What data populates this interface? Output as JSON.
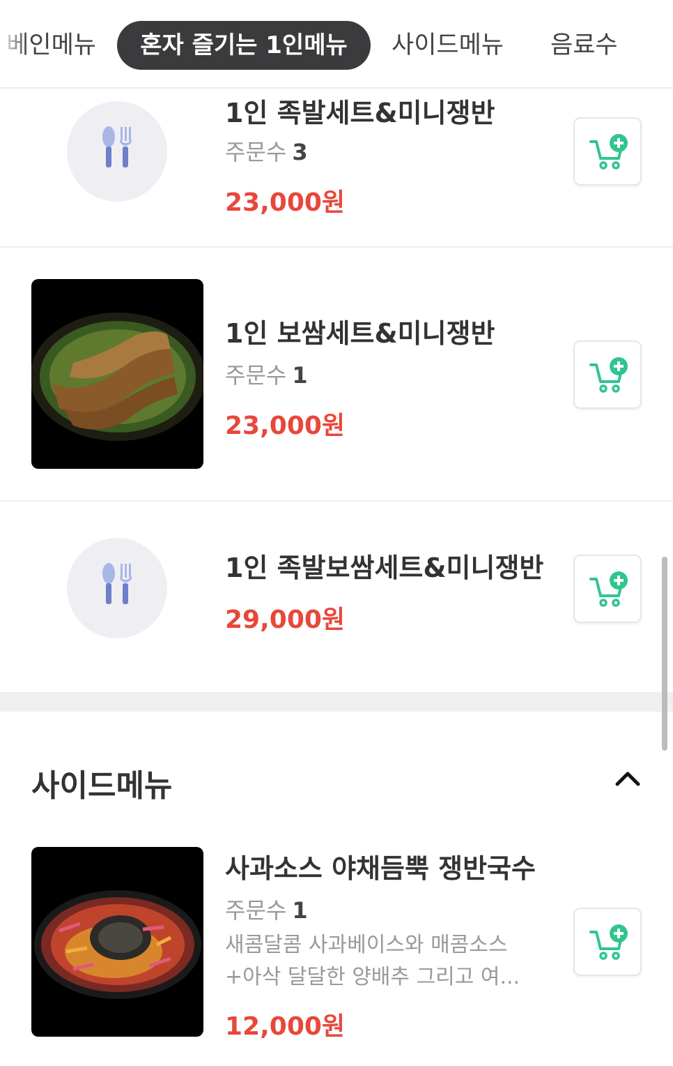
{
  "tabs": [
    {
      "label": "베인메뉴",
      "active": false
    },
    {
      "label": "혼자 즐기는 1인메뉴",
      "active": true
    },
    {
      "label": "사이드메뉴",
      "active": false
    },
    {
      "label": "음료수",
      "active": false
    }
  ],
  "items": [
    {
      "name": "1인 족발세트&미니쟁반",
      "orders_label": "주문수",
      "orders": "3",
      "price": "23,000원"
    },
    {
      "name": "1인 보쌈세트&미니쟁반",
      "orders_label": "주문수",
      "orders": "1",
      "price": "23,000원"
    },
    {
      "name": "1인 족발보쌈세트&미니쟁반",
      "price": "29,000원"
    }
  ],
  "side_section": {
    "title": "사이드메뉴",
    "items": [
      {
        "name": "사과소스 야채듬뿍 쟁반국수",
        "orders_label": "주문수",
        "orders": "1",
        "desc_line1": "새콤달콤 사과베이스와 매콤소스",
        "desc_line2": "+아삭 달달한 양배추 그리고 여...",
        "price": "12,000원"
      }
    ]
  },
  "colors": {
    "accent_green": "#2fc58f",
    "price_red": "#e8473b",
    "active_tab_bg": "#3b3b3d"
  },
  "icons": {
    "cart": "cart-add-icon",
    "placeholder": "utensils-icon",
    "collapse": "chevron-up-icon"
  }
}
